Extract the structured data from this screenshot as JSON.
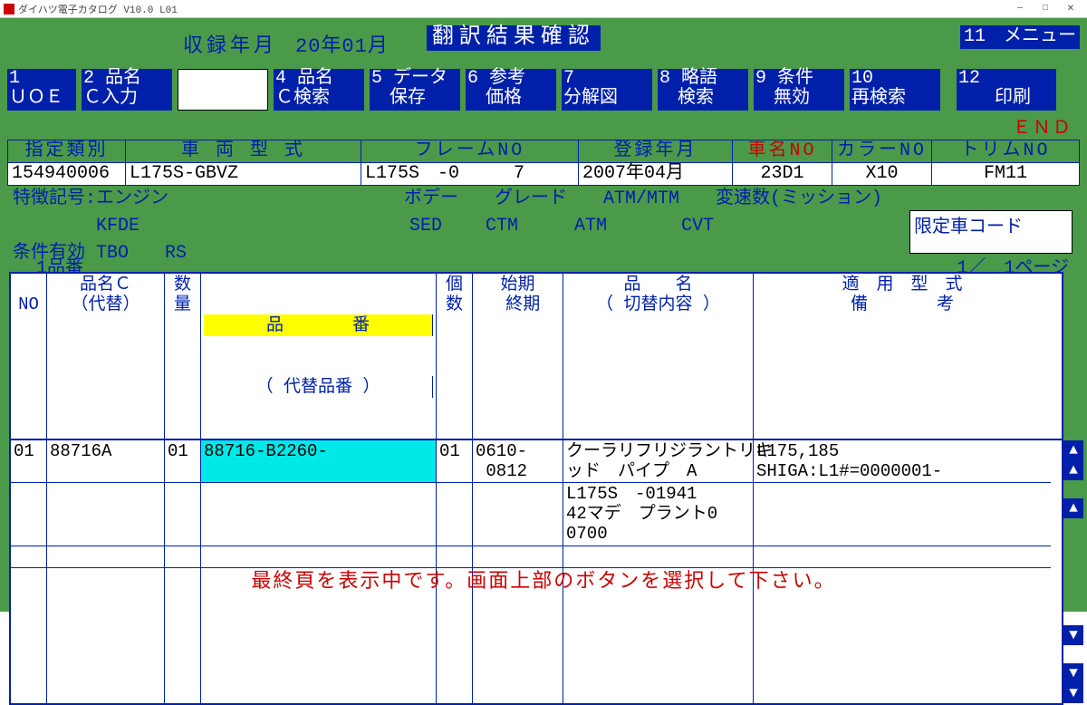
{
  "window": {
    "title": "ダイハツ電子カタログ V10.0 L01",
    "min": "—",
    "max": "□",
    "close": "✕"
  },
  "header": {
    "record_label": "収録年月",
    "record_value": "20年01月",
    "title_band": "翻訳結果確認",
    "menu": "11　メニュー"
  },
  "func": {
    "f1": "1\nＵＯＥ",
    "f2": "2 品名\nＣ入力",
    "f4": "4 品名\nＣ検索",
    "f5": "5 データ\n　保存",
    "f6": "6 参考\n　価格",
    "f7": "7\n分解図",
    "f8": "8 略語\n　検索",
    "f9": "9 条件\n　無効",
    "f10": "10\n再検索",
    "f12": "12\n　　印刷"
  },
  "end": "ＥＮＤ",
  "info": {
    "h1": "指定類別",
    "h2": "車 両 型 式",
    "h3": "フレームNO",
    "h4": "登録年月",
    "h5": "車名NO",
    "h6": "カラーNO",
    "h7": "トリムNO",
    "v1": "154940006",
    "v2": "L175S-GBVZ",
    "v3": "L175S　-0　　　7",
    "v4": "2007年04月",
    "v5": "23D1",
    "v6": "X10",
    "v7": "FM11"
  },
  "spec": {
    "l1a": "特徴記号:エンジン",
    "l1b": "ボデー",
    "l1c": "グレード",
    "l1d": "ATM/MTM",
    "l1e": "変速数(ミッション)",
    "l2a": "　　　　 KFDE",
    "l2b": "SED",
    "l2c": "CTM",
    "l2d": "ATM",
    "l2e": "CVT",
    "l3a": "条件有効 TBO　　RS"
  },
  "limited": "限定車コード",
  "parts_label": "1品番",
  "page": "1／　1ページ",
  "cols": {
    "no": "\nNO",
    "name": "品名Ｃ\n（代替）",
    "qty": "数\n量",
    "pn_top": "品　　　　番",
    "pn_bot": "（ 代替品番 ）",
    "cnt": "個\n数",
    "date": "始期\n 終期",
    "desc": "品　　名\n（ 切替内容 ）",
    "model": "適　用　型　式\n備　　　　考"
  },
  "rows": [
    {
      "no": "01",
      "name": "88716A",
      "qty": "01",
      "pn": "88716-B2260-",
      "cnt": "01",
      "date": "0610-\n 0812",
      "desc": "クーラリフリジラントリキ\nッド　パイプ　A",
      "model": "L175,185\nSHIGA:L1#=0000001-"
    },
    {
      "no": "",
      "name": "",
      "qty": "",
      "pn": "",
      "cnt": "",
      "date": "",
      "desc": "L175S　-01941\n42マデ　プラント0\n0700",
      "model": ""
    }
  ],
  "scroll": {
    "up": "▲",
    "down": "▼"
  },
  "footer": "最終頁を表示中です。画面上部のボタンを選択して下さい。"
}
